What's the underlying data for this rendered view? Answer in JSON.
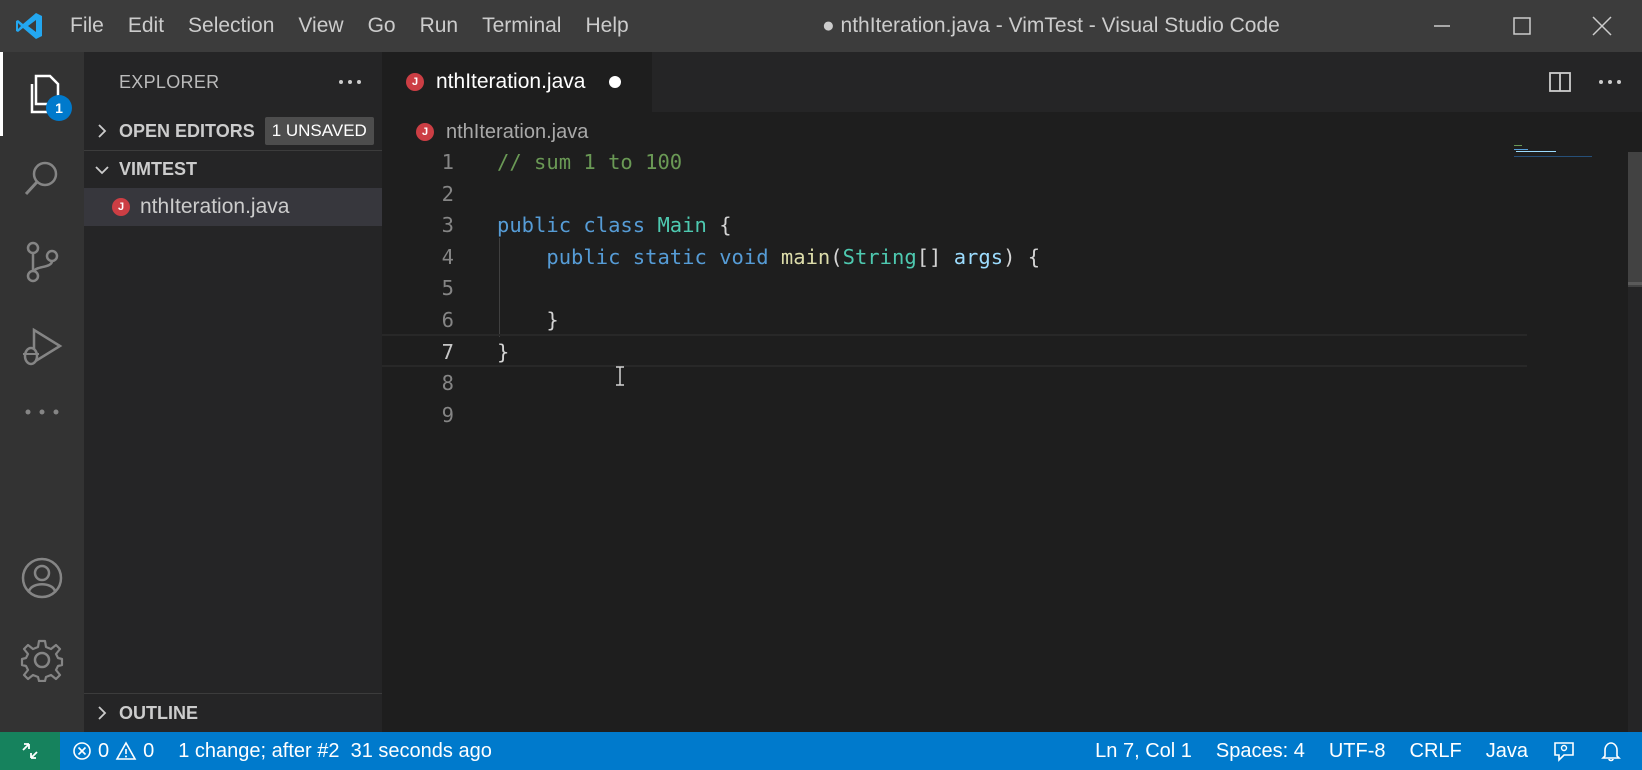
{
  "titlebar": {
    "menu": [
      "File",
      "Edit",
      "Selection",
      "View",
      "Go",
      "Run",
      "Terminal",
      "Help"
    ],
    "window_title": "● nthIteration.java - VimTest - Visual Studio Code",
    "icons": [
      "vscode-logo",
      "minimize-icon",
      "maximize-icon",
      "close-icon"
    ]
  },
  "activitybar": {
    "explorer_badge": "1",
    "icons": [
      "files-icon",
      "search-icon",
      "source-control-icon",
      "run-debug-icon",
      "more-icon",
      "account-icon",
      "settings-gear-icon"
    ]
  },
  "sidebar": {
    "title": "EXPLORER",
    "open_editors_label": "OPEN EDITORS",
    "unsaved_badge": "1 UNSAVED",
    "folder_label": "VIMTEST",
    "file_icon_letter": "J",
    "file_name": "nthIteration.java",
    "outline_label": "OUTLINE"
  },
  "editor": {
    "tab_label": "nthIteration.java",
    "breadcrumb": "nthIteration.java",
    "line_numbers": [
      "1",
      "2",
      "3",
      "4",
      "5",
      "6",
      "7",
      "8",
      "9"
    ],
    "code": {
      "l1_comment": "// sum 1 to 100",
      "l3_kw1": "public",
      "l3_kw2": "class",
      "l3_type": "Main",
      "l3_brace": "{",
      "l4_kw1": "public",
      "l4_kw2": "static",
      "l4_kw3": "void",
      "l4_fn": "main",
      "l4_open": "(",
      "l4_type": "String",
      "l4_brackets": "[]",
      "l4_param": "args",
      "l4_close": ")",
      "l4_brace": "{",
      "l6_brace": "}",
      "l7_brace": "}"
    },
    "current_line": 7
  },
  "statusbar": {
    "errors": "0",
    "warnings": "0",
    "undo_info": "1 change; after #2  31 seconds ago",
    "position": "Ln 7, Col 1",
    "spaces": "Spaces: 4",
    "encoding": "UTF-8",
    "eol": "CRLF",
    "language": "Java",
    "colors": {
      "background": "#007acc",
      "remote": "#16825d"
    }
  }
}
